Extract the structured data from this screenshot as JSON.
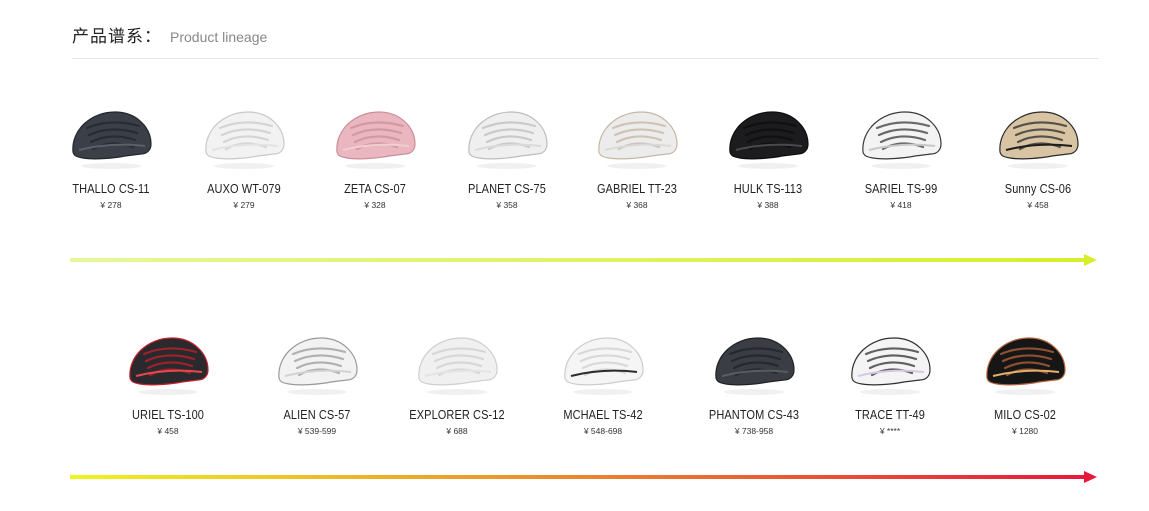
{
  "header": {
    "title_cn": "产品谱系：",
    "title_en": "Product lineage"
  },
  "rows": [
    {
      "items": [
        {
          "name": "THALLO CS-11",
          "price": "¥ 278",
          "helmet": {
            "shell": "#3b3f47",
            "shade": "#22252b",
            "accent": "#5a5f69"
          }
        },
        {
          "name": "AUXO WT-079",
          "price": "¥ 279",
          "helmet": {
            "shell": "#f2f2f2",
            "shade": "#c9c9c9",
            "accent": "#e3e3e3"
          }
        },
        {
          "name": "ZETA CS-07",
          "price": "¥ 328",
          "helmet": {
            "shell": "#eab6c0",
            "shade": "#c98e9a",
            "accent": "#f3cdd4"
          }
        },
        {
          "name": "PLANET CS-75",
          "price": "¥ 358",
          "helmet": {
            "shell": "#efefef",
            "shade": "#bdbdbd",
            "accent": "#dadada"
          }
        },
        {
          "name": "GABRIEL TT-23",
          "price": "¥ 368",
          "helmet": {
            "shell": "#ececec",
            "shade": "#c6b7a2",
            "accent": "#d9d9d9"
          }
        },
        {
          "name": "HULK TS-113",
          "price": "¥ 388",
          "helmet": {
            "shell": "#1c1c1e",
            "shade": "#0c0c0d",
            "accent": "#4a4a4d"
          }
        },
        {
          "name": "SARIEL TS-99",
          "price": "¥ 418",
          "helmet": {
            "shell": "#f3f3f3",
            "shade": "#3a3a3a",
            "accent": "#c8c8c8"
          }
        },
        {
          "name": "Sunny CS-06",
          "price": "¥ 458",
          "helmet": {
            "shell": "#d8c4a3",
            "shade": "#2a2a2a",
            "accent": "#1d1d1d"
          }
        }
      ]
    },
    {
      "items": [
        {
          "name": "URIEL TS-100",
          "price": "¥ 458",
          "helmet": {
            "shell": "#2a2a2e",
            "shade": "#c4202a",
            "accent": "#e8474f"
          }
        },
        {
          "name": "ALIEN CS-57",
          "price": "¥ 539-599",
          "helmet": {
            "shell": "#f2f2f2",
            "shade": "#9a9a9a",
            "accent": "#d3d3d3"
          }
        },
        {
          "name": "EXPLORER CS-12",
          "price": "¥ 688",
          "helmet": {
            "shell": "#f0f0f0",
            "shade": "#cfcfcf",
            "accent": "#e4e4e4"
          }
        },
        {
          "name": "MCHAEL TS-42",
          "price": "¥ 548-698",
          "helmet": {
            "shell": "#f5f5f5",
            "shade": "#cdcdcd",
            "accent": "#2b2b2b"
          }
        },
        {
          "name": "PHANTOM CS-43",
          "price": "¥ 738-958",
          "helmet": {
            "shell": "#3a3d43",
            "shade": "#1f2125",
            "accent": "#585c63"
          }
        },
        {
          "name": "TRACE TT-49",
          "price": "¥ ****",
          "helmet": {
            "shell": "#f4f4f4",
            "shade": "#2f2f2f",
            "accent": "#d9c6e6"
          }
        },
        {
          "name": "MILO CS-02",
          "price": "¥ 1280",
          "helmet": {
            "shell": "#161616",
            "shade": "#b5653b",
            "accent": "#e3b26e"
          }
        }
      ]
    }
  ],
  "arrows": [
    {
      "from_color": "#e6f79a",
      "to_color": "#d7ee2a"
    },
    {
      "from_color": "#eef41e",
      "to_color": "#e8183c"
    }
  ]
}
